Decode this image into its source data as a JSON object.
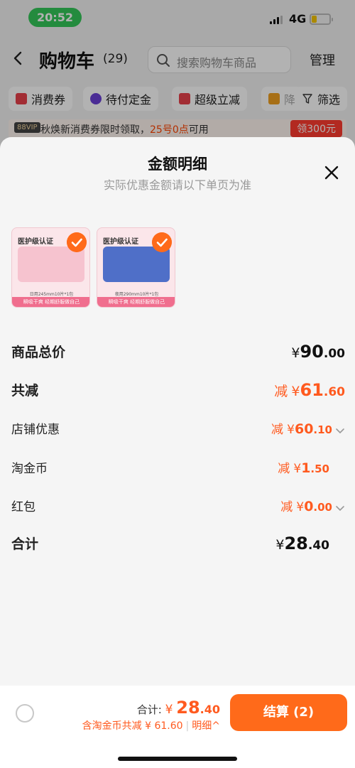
{
  "status_bar": {
    "time": "20:52",
    "network": "4G",
    "battery_percent": 30
  },
  "cart": {
    "title": "购物车",
    "count": "(29)",
    "search_placeholder": "搜索购物车商品",
    "manage": "管理",
    "chips": [
      {
        "label": "消费券",
        "icon": "coupon-icon",
        "color": "#e8414b"
      },
      {
        "label": "待付定金",
        "icon": "clock-icon",
        "color": "#6a3fd6"
      },
      {
        "label": "超级立减",
        "icon": "arrow-down-icon",
        "color": "#e8414b"
      },
      {
        "label": "降",
        "icon": "price-drop-icon",
        "color": "#f0a020"
      },
      {
        "label": "筛选",
        "icon": "filter-icon",
        "color": "#333333"
      }
    ],
    "vip_bar": {
      "badge": "88VIP",
      "text_prefix": "秋焕新消费券限时领取，",
      "text_highlight": "25号0点",
      "text_suffix": "可用",
      "claim": "领300元"
    }
  },
  "sheet": {
    "title": "金额明细",
    "subtitle": "实际优惠金额请以下单页为准",
    "products": [
      {
        "label": "医护级认证",
        "spec": "日用245mm10片*1包",
        "strip": "瞬吸干爽 经期舒服做自己",
        "pack_color": "#f6c3cf",
        "selected": true
      },
      {
        "label": "医护级认证",
        "spec": "夜用290mm10片*1包",
        "strip": "瞬吸干爽 经期舒服做自己",
        "pack_color": "#4f6fc8",
        "selected": true
      }
    ],
    "rows": [
      {
        "label": "商品总价",
        "prefix": "",
        "yen": "¥",
        "int": "90",
        "dec": ".00",
        "bold": true,
        "style": "dark"
      },
      {
        "label": "共减",
        "prefix": "减",
        "yen": "¥",
        "int": "61",
        "dec": ".60",
        "bold": true,
        "style": "orange"
      },
      {
        "label": "店铺优惠",
        "prefix": "减",
        "yen": "¥",
        "int": "60",
        "dec": ".10",
        "bold": false,
        "style": "orange",
        "chevron": true
      },
      {
        "label": "淘金币",
        "prefix": "减",
        "yen": "¥",
        "int": "1",
        "dec": ".50",
        "bold": false,
        "style": "orange"
      },
      {
        "label": "红包",
        "prefix": "减",
        "yen": "¥",
        "int": "0",
        "dec": ".00",
        "bold": false,
        "style": "orange",
        "chevron": true
      },
      {
        "label": "合计",
        "prefix": "",
        "yen": "¥",
        "int": "28",
        "dec": ".40",
        "bold": true,
        "style": "dark"
      }
    ]
  },
  "bottom_bar": {
    "total_label": "合计:",
    "total_yen": "¥",
    "total_int": "28",
    "total_dec": ".40",
    "discount_text": "含淘金币共减 ¥ 61.60",
    "detail_text": "明细^",
    "checkout": "结算 (2)"
  },
  "colors": {
    "accent": "#ff6a1a",
    "discount": "#ff5a1f"
  }
}
